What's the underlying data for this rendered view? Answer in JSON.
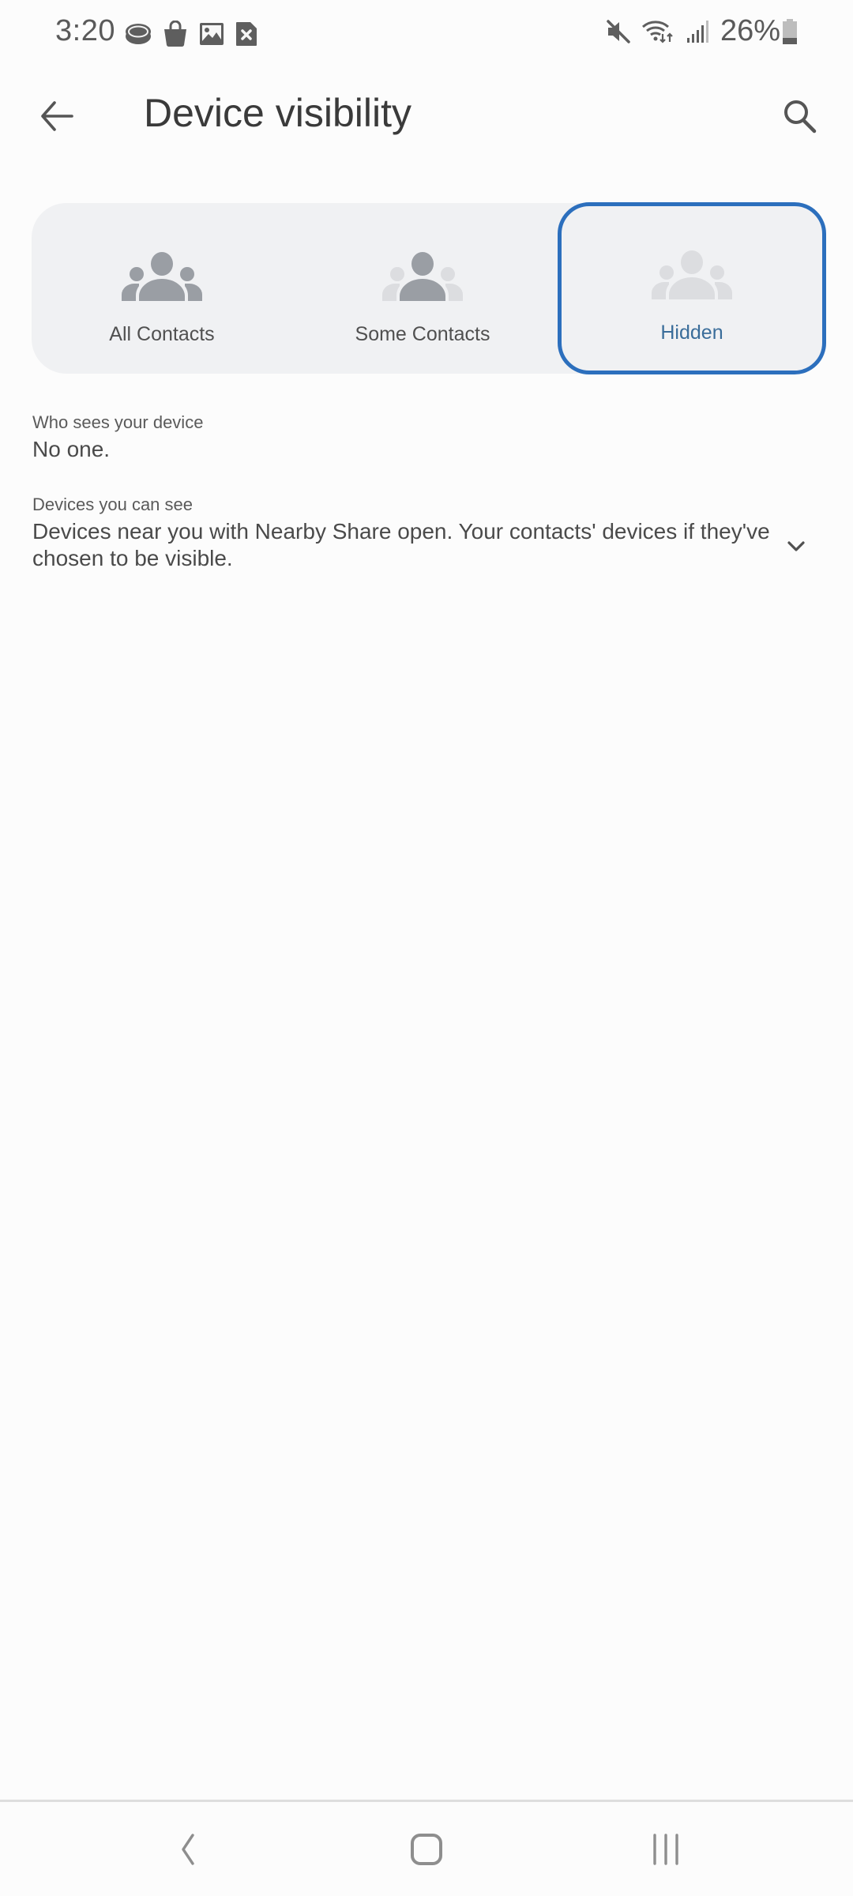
{
  "status_bar": {
    "time": "3:20",
    "left_icons": [
      "hockey-puck-notification-icon",
      "shopping-bag-icon",
      "image-icon",
      "sim-error-icon"
    ],
    "right_icons": [
      "mute-icon",
      "wifi-data-icon",
      "signal-icon"
    ],
    "battery_percent": "26%"
  },
  "app_bar": {
    "title": "Device visibility",
    "back_icon": "arrow-back-icon",
    "search_icon": "search-icon"
  },
  "visibility_options": [
    {
      "label": "All Contacts",
      "icon": "people-icon",
      "selected": false
    },
    {
      "label": "Some Contacts",
      "icon": "people-partial-icon",
      "selected": false
    },
    {
      "label": "Hidden",
      "icon": "people-hidden-icon",
      "selected": true
    }
  ],
  "colors": {
    "accent": "#2c6fbd",
    "selected_label": "#3a6d9a",
    "selector_bg": "#f0f1f3",
    "icon_dark": "#9a9ea4",
    "icon_light": "#dcdde0"
  },
  "who_sees": {
    "label": "Who sees your device",
    "value": "No one."
  },
  "devices_you_see": {
    "label": "Devices you can see",
    "value": "Devices near you with Nearby Share open. Your contacts' devices if they've chosen to be visible.",
    "expand_icon": "chevron-down-icon"
  },
  "nav_bar": {
    "back": "nav-back-icon",
    "home": "nav-home-icon",
    "recents": "nav-recents-icon"
  }
}
